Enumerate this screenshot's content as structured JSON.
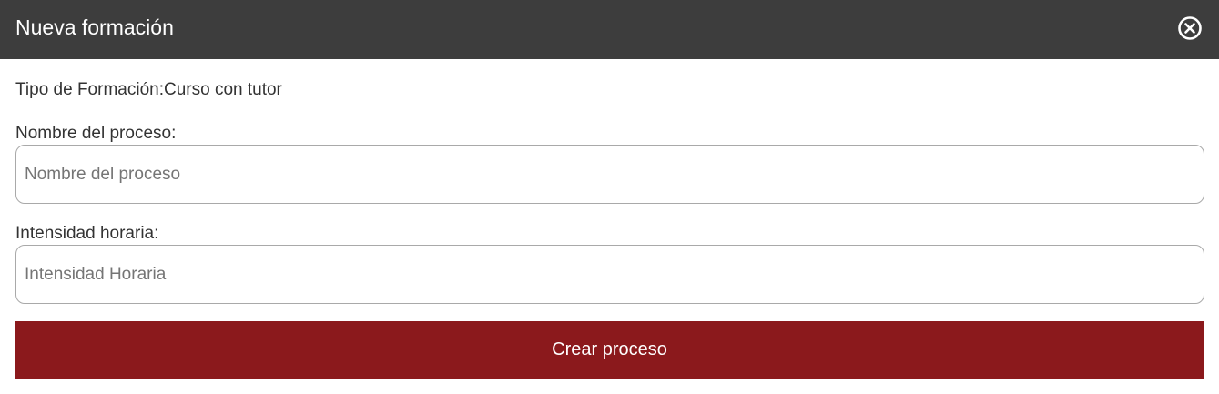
{
  "modal": {
    "title": "Nueva formación",
    "close_icon": "circle-x-icon"
  },
  "form": {
    "tipo_label": "Tipo de Formación:",
    "tipo_value": "Curso con tutor",
    "nombre_label": "Nombre del proceso:",
    "nombre_placeholder": "Nombre del proceso",
    "nombre_value": "",
    "intensidad_label": "Intensidad horaria:",
    "intensidad_placeholder": "Intensidad Horaria",
    "intensidad_value": "",
    "submit_label": "Crear proceso"
  },
  "colors": {
    "header_bg": "#3d3d3d",
    "accent": "#8b191c"
  }
}
